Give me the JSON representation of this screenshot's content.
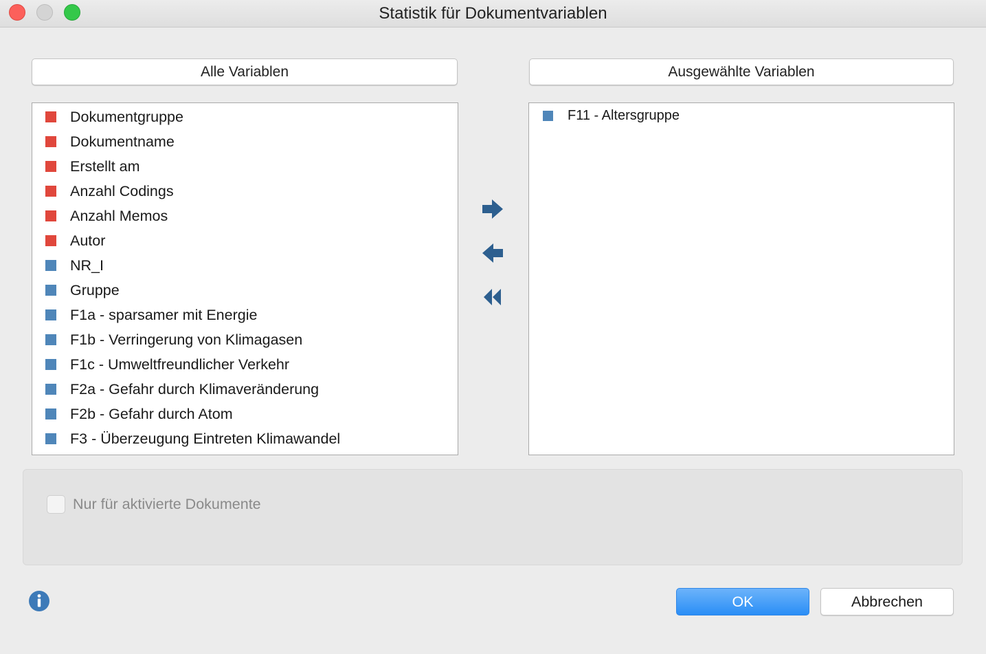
{
  "window": {
    "title": "Statistik für Dokumentvariablen"
  },
  "all_variables": {
    "header": "Alle Variablen",
    "items": [
      {
        "label": "Dokumentgruppe",
        "kind": "system",
        "color": "#e0473c"
      },
      {
        "label": "Dokumentname",
        "kind": "system",
        "color": "#e0473c"
      },
      {
        "label": "Erstellt am",
        "kind": "system",
        "color": "#e0473c"
      },
      {
        "label": "Anzahl Codings",
        "kind": "system",
        "color": "#e0473c"
      },
      {
        "label": "Anzahl Memos",
        "kind": "system",
        "color": "#e0473c"
      },
      {
        "label": "Autor",
        "kind": "system",
        "color": "#e0473c"
      },
      {
        "label": "NR_I",
        "kind": "user",
        "color": "#4f86b9"
      },
      {
        "label": "Gruppe",
        "kind": "user",
        "color": "#4f86b9"
      },
      {
        "label": "F1a - sparsamer mit Energie",
        "kind": "user",
        "color": "#4f86b9"
      },
      {
        "label": "F1b - Verringerung von Klimagasen",
        "kind": "user",
        "color": "#4f86b9"
      },
      {
        "label": "F1c - Umweltfreundlicher Verkehr",
        "kind": "user",
        "color": "#4f86b9"
      },
      {
        "label": "F2a - Gefahr durch Klimaveränderung",
        "kind": "user",
        "color": "#4f86b9"
      },
      {
        "label": "F2b - Gefahr durch Atom",
        "kind": "user",
        "color": "#4f86b9"
      },
      {
        "label": "F3 - Überzeugung Eintreten Klimawandel",
        "kind": "user",
        "color": "#4f86b9"
      }
    ]
  },
  "selected_variables": {
    "header": "Ausgewählte Variablen",
    "items": [
      {
        "label": "F11 - Altersgruppe",
        "kind": "user",
        "color": "#4f86b9"
      }
    ]
  },
  "transfer_buttons": {
    "add_icon": "arrow-right-icon",
    "remove_icon": "arrow-left-icon",
    "remove_all_icon": "double-arrow-left-icon",
    "color": "#2d5f8f"
  },
  "options": {
    "only_activated_label": "Nur für aktivierte Dokumente",
    "only_activated_checked": false
  },
  "footer": {
    "info_icon": "info-icon",
    "ok_label": "OK",
    "cancel_label": "Abbrechen"
  }
}
